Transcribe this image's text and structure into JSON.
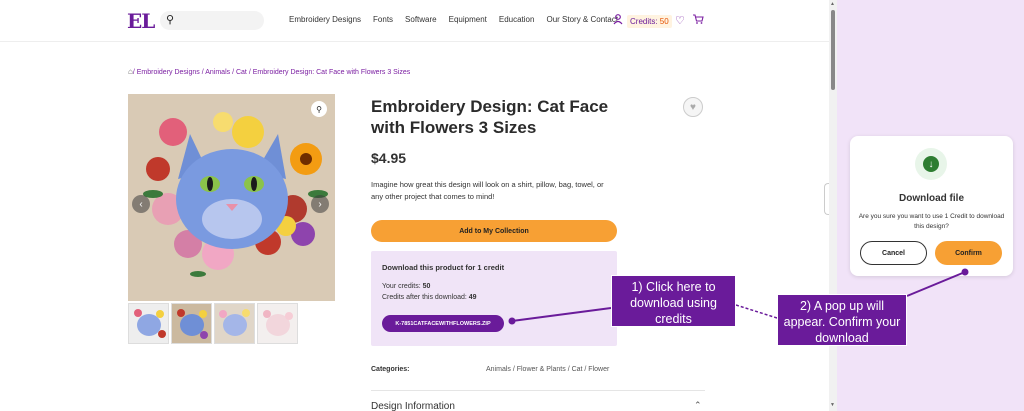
{
  "header": {
    "logo": "EL",
    "nav": [
      "Embroidery Designs",
      "Fonts",
      "Software",
      "Equipment",
      "Education",
      "Our Story & Contact"
    ],
    "credits_label": "Credits:",
    "credits_value": "50"
  },
  "breadcrumb": {
    "items": [
      "/ Embroidery Designs",
      "/ Animals",
      "/ Cat",
      "/ Embroidery Design: Cat Face with Flowers 3 Sizes"
    ],
    "text": " / Embroidery Designs / Animals / Cat / Embroidery Design: Cat Face with Flowers 3 Sizes"
  },
  "product": {
    "title": "Embroidery Design: Cat Face with Flowers 3 Sizes",
    "price": "$4.95",
    "description": "Imagine how great this design will look on a shirt, pillow, bag, towel, or any other project that comes to mind!",
    "add_button": "Add to My Collection",
    "categories_label": "Categories:",
    "categories_value": "Animals / Flower & Plants / Cat / Flower",
    "design_info": "Design Information"
  },
  "download_box": {
    "title": "Download this product for 1 credit",
    "your_credits": "Your credits: ",
    "your_credits_value": "50",
    "after_download": "Credits after this download: ",
    "after_download_value": "49",
    "zip_button": "K-7851CATFACEWITHFLOWERS.ZIP"
  },
  "modal": {
    "title": "Download file",
    "text": "Are you sure you want to use 1 Credit to download this design?",
    "cancel": "Cancel",
    "confirm": "Confirm"
  },
  "callouts": {
    "one": "1) Click here to download using credits",
    "two": "2) A pop up will appear. Confirm your download"
  },
  "colors": {
    "brand_purple": "#6a1b9a",
    "accent_orange": "#f7a034",
    "panel_lavender": "#f1e3f8"
  }
}
